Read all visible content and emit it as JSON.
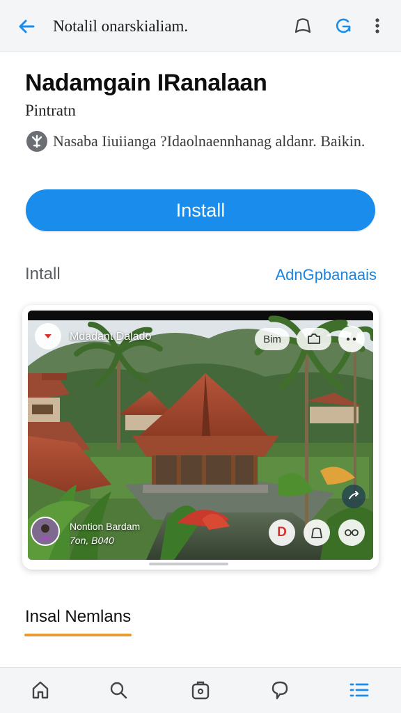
{
  "topbar": {
    "title": "Notalil onarskialiam.",
    "back_icon": "arrow-left-icon",
    "actions": [
      "bookmark-icon",
      "refresh-icon",
      "more-vertical-icon"
    ]
  },
  "app": {
    "name": "Nadamgain IRanalaan",
    "developer": "Pintratn",
    "info_text": "Nasaba Iiuiianga ?Idaolnaennhanag aldanr. Baikin."
  },
  "install": {
    "label": "Install"
  },
  "section": {
    "label": "Intall",
    "link": "AdnGpbanaais"
  },
  "screenshot": {
    "top_label": "Mdadant Dalado",
    "pill_label": "Bim",
    "author_name": "Nontion Bardam",
    "author_sub": "7on, B040",
    "badge_letter": "D"
  },
  "tabs": {
    "active_label": "Insal Nemlans"
  },
  "bottom_nav": [
    "home-icon",
    "search-icon",
    "apps-icon",
    "chat-icon",
    "list-icon"
  ],
  "colors": {
    "accent": "#1a8cec",
    "link": "#1a84e0",
    "tab_underline": "#e99b32",
    "nav_active": "#1a8cec"
  }
}
